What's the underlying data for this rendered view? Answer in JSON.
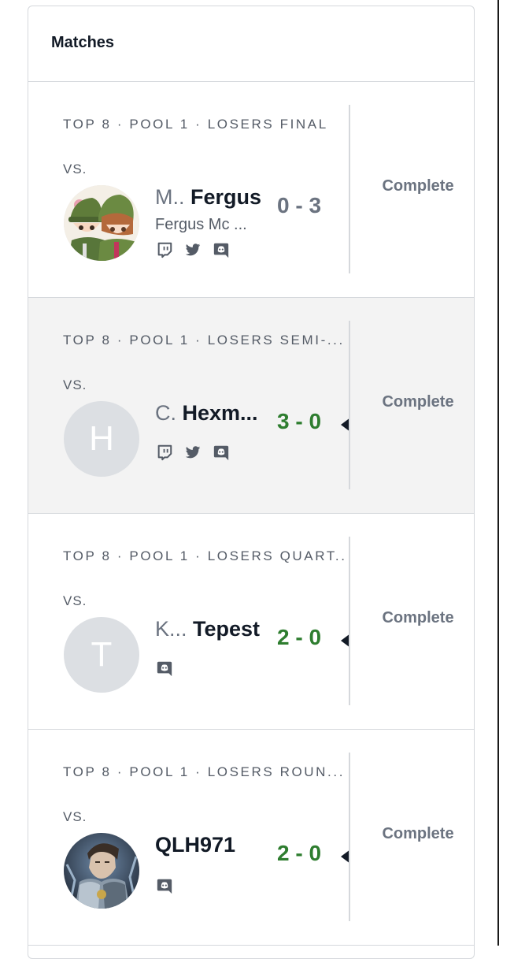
{
  "panel": {
    "title": "Matches"
  },
  "colors": {
    "win": "#2e7d2f",
    "loss": "#6b7380",
    "highlight_bg": "#f3f3f3"
  },
  "matches": [
    {
      "round": "TOP 8 · POOL 1 · LOSERS FINAL",
      "vs": "VS.",
      "opponent": {
        "prefix": "M..",
        "tag": "Fergus",
        "real_name": "Fergus Mc ...",
        "avatar": "anime-portrait",
        "socials": [
          "twitch-icon",
          "twitter-icon",
          "discord-icon"
        ]
      },
      "score": "0 - 3",
      "result": "loss",
      "status": "Complete"
    },
    {
      "round": "TOP 8 · POOL 1 · LOSERS SEMI-...",
      "vs": "VS.",
      "opponent": {
        "prefix": "C.",
        "tag": "Hexm...",
        "avatar_letter": "H",
        "socials": [
          "twitch-icon",
          "twitter-icon",
          "discord-icon"
        ]
      },
      "score": "3 - 0",
      "result": "win",
      "status": "Complete"
    },
    {
      "round": "TOP 8 · POOL 1 · LOSERS QUART...",
      "vs": "VS.",
      "opponent": {
        "prefix": "K...",
        "tag": "Tepest",
        "avatar_letter": "T",
        "socials": [
          "discord-icon"
        ]
      },
      "score": "2 - 0",
      "result": "win",
      "status": "Complete"
    },
    {
      "round": "TOP 8 · POOL 1 · LOSERS ROUN...",
      "vs": "VS.",
      "opponent": {
        "tag": "QLH971",
        "avatar": "armored-character-portrait",
        "socials": [
          "discord-icon"
        ]
      },
      "score": "2 - 0",
      "result": "win",
      "status": "Complete"
    }
  ]
}
